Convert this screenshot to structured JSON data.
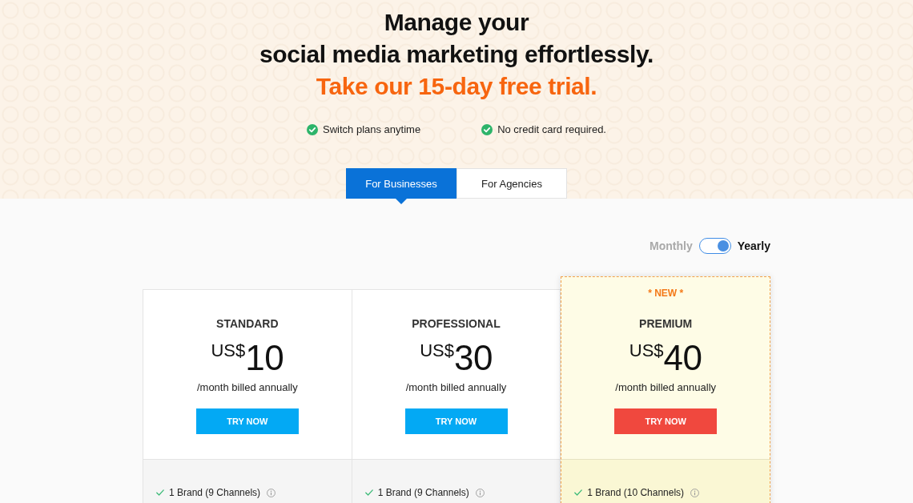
{
  "hero": {
    "title_lines": [
      "Manage your",
      "social media marketing effortlessly."
    ],
    "offer": "Take our 15-day free trial.",
    "perks": [
      "Switch plans anytime",
      "No credit card required."
    ]
  },
  "audience_tabs": [
    {
      "label": "For Businesses",
      "selected": true
    },
    {
      "label": "For Agencies",
      "selected": false
    }
  ],
  "billing": {
    "left_label": "Monthly",
    "right_label": "Yearly",
    "on": true
  },
  "plans": [
    {
      "name": "STANDARD",
      "featured": false,
      "currency": "US$",
      "amount": "10",
      "period": "/month billed annually",
      "button": "TRY NOW",
      "features": [
        "1 Brand (9 Channels)"
      ]
    },
    {
      "name": "PROFESSIONAL",
      "featured": false,
      "currency": "US$",
      "amount": "30",
      "period": "/month billed annually",
      "button": "TRY NOW",
      "features": [
        "1 Brand (9 Channels)"
      ]
    },
    {
      "name": "PREMIUM",
      "featured": true,
      "badge": "* NEW *",
      "currency": "US$",
      "amount": "40",
      "period": "/month billed annually",
      "button": "TRY NOW",
      "features": [
        "1 Brand (10 Channels)"
      ]
    }
  ]
}
